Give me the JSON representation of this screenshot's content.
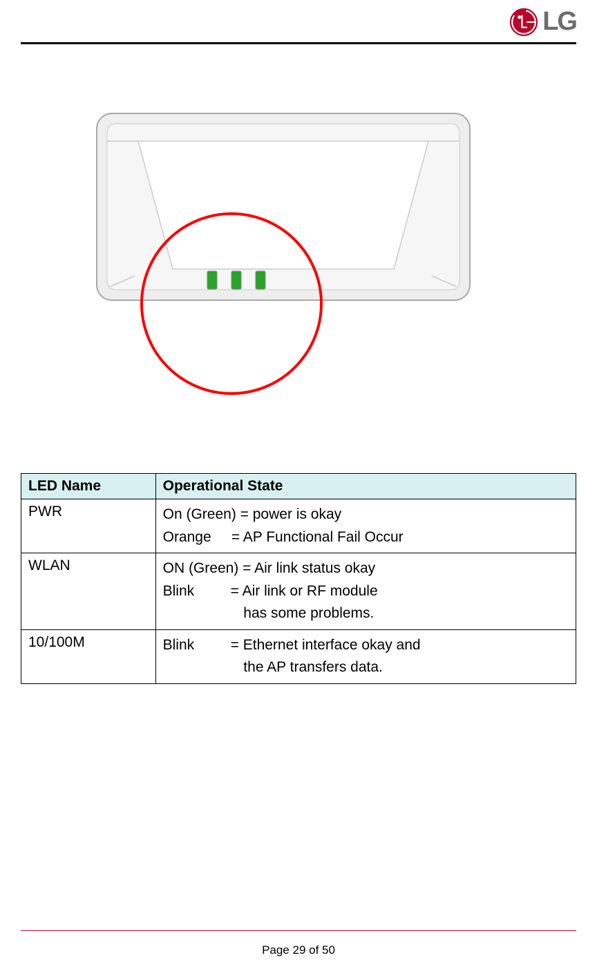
{
  "logo": {
    "brand": "LG"
  },
  "table": {
    "headers": {
      "col1": "LED Name",
      "col2": "Operational State"
    },
    "rows": [
      {
        "name": "PWR",
        "state_line1": "On (Green) = power is okay",
        "state_line2": "Orange     = AP Functional Fail Occur"
      },
      {
        "name": "WLAN",
        "state_line1": "ON (Green) = Air link status okay",
        "state_line2": "Blink         = Air link or RF module",
        "state_line3": "                    has some problems."
      },
      {
        "name": "10/100M",
        "state_line1": "Blink         = Ethernet interface okay and",
        "state_line2": "                    the AP transfers data."
      }
    ]
  },
  "footer": {
    "page_label": "Page 29 of 50"
  }
}
